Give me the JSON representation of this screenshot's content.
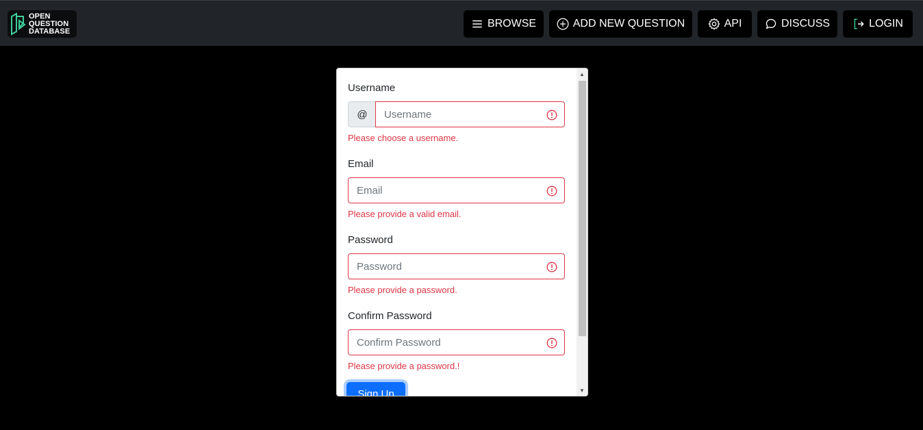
{
  "navbar": {
    "logo": {
      "lines": [
        "OPEN",
        "QUESTION",
        "DATABASE"
      ]
    },
    "buttons": {
      "browse": {
        "label": "BROWSE",
        "icon": "list-icon"
      },
      "add": {
        "label": "ADD NEW QUESTION",
        "icon": "plus-circle-icon"
      },
      "api": {
        "label": "API",
        "icon": "gear-icon"
      },
      "discuss": {
        "label": "DISCUSS",
        "icon": "chat-icon"
      },
      "login": {
        "label": "LOGIN",
        "icon": "login-arrow-icon"
      }
    }
  },
  "form": {
    "username": {
      "label": "Username",
      "addon": "@",
      "placeholder": "Username",
      "error": "Please choose a username."
    },
    "email": {
      "label": "Email",
      "placeholder": "Email",
      "error": "Please provide a valid email."
    },
    "password": {
      "label": "Password",
      "placeholder": "Password",
      "error": "Please provide a password."
    },
    "confirm": {
      "label": "Confirm Password",
      "placeholder": "Confirm Password",
      "error": "Please provide a password.!"
    },
    "submit_label": "Sign Up"
  },
  "colors": {
    "navbar_bg": "#212529",
    "error": "#dc3545",
    "primary": "#0d6efd",
    "logo_accent": "#3ecf9b"
  }
}
